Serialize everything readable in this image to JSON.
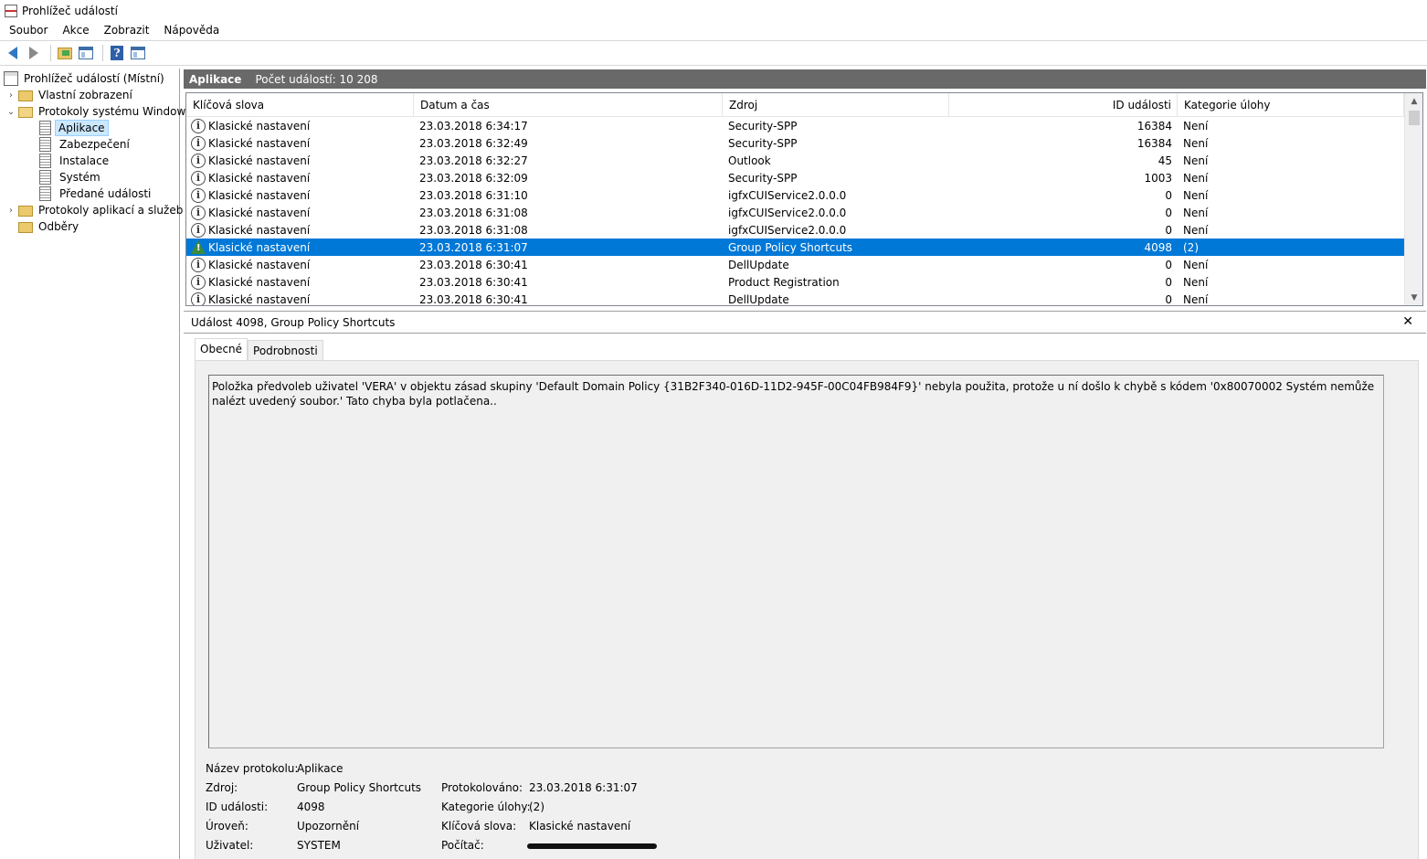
{
  "window": {
    "title": "Prohlížeč událostí"
  },
  "menu": [
    "Soubor",
    "Akce",
    "Zobrazit",
    "Nápověda"
  ],
  "toolbar": {
    "buttons": [
      "back-icon",
      "forward-icon",
      "open-folder-icon",
      "show-hide-tree-icon",
      "help-icon",
      "show-hide-action-pane-icon"
    ]
  },
  "tree": {
    "root": "Prohlížeč událostí (Místní)",
    "custom_views": "Vlastní zobrazení",
    "windows_logs": "Protokoly systému Windows",
    "logs": [
      "Aplikace",
      "Zabezpečení",
      "Instalace",
      "Systém",
      "Předané události"
    ],
    "app_services_logs": "Protokoly aplikací a služeb",
    "subscriptions": "Odběry"
  },
  "log_header": {
    "name": "Aplikace",
    "count_text": "Počet událostí: 10 208"
  },
  "events_table": {
    "columns": [
      "Klíčová slova",
      "Datum a čas",
      "Zdroj",
      "ID události",
      "Kategorie úlohy"
    ],
    "rows": [
      {
        "level": "info",
        "keywords": "Klasické nastavení",
        "datetime": "23.03.2018 6:34:17",
        "source": "Security-SPP",
        "id": "16384",
        "category": "Není"
      },
      {
        "level": "info",
        "keywords": "Klasické nastavení",
        "datetime": "23.03.2018 6:32:49",
        "source": "Security-SPP",
        "id": "16384",
        "category": "Není"
      },
      {
        "level": "info",
        "keywords": "Klasické nastavení",
        "datetime": "23.03.2018 6:32:27",
        "source": "Outlook",
        "id": "45",
        "category": "Není"
      },
      {
        "level": "info",
        "keywords": "Klasické nastavení",
        "datetime": "23.03.2018 6:32:09",
        "source": "Security-SPP",
        "id": "1003",
        "category": "Není"
      },
      {
        "level": "info",
        "keywords": "Klasické nastavení",
        "datetime": "23.03.2018 6:31:10",
        "source": "igfxCUIService2.0.0.0",
        "id": "0",
        "category": "Není"
      },
      {
        "level": "info",
        "keywords": "Klasické nastavení",
        "datetime": "23.03.2018 6:31:08",
        "source": "igfxCUIService2.0.0.0",
        "id": "0",
        "category": "Není"
      },
      {
        "level": "info",
        "keywords": "Klasické nastavení",
        "datetime": "23.03.2018 6:31:08",
        "source": "igfxCUIService2.0.0.0",
        "id": "0",
        "category": "Není"
      },
      {
        "level": "warning",
        "keywords": "Klasické nastavení",
        "datetime": "23.03.2018 6:31:07",
        "source": "Group Policy Shortcuts",
        "id": "4098",
        "category": "(2)"
      },
      {
        "level": "info",
        "keywords": "Klasické nastavení",
        "datetime": "23.03.2018 6:30:41",
        "source": "DellUpdate",
        "id": "0",
        "category": "Není"
      },
      {
        "level": "info",
        "keywords": "Klasické nastavení",
        "datetime": "23.03.2018 6:30:41",
        "source": "Product Registration",
        "id": "0",
        "category": "Není"
      },
      {
        "level": "info",
        "keywords": "Klasické nastavení",
        "datetime": "23.03.2018 6:30:41",
        "source": "DellUpdate",
        "id": "0",
        "category": "Není"
      }
    ],
    "selected_index": 7
  },
  "detail": {
    "title": "Událost 4098, Group Policy Shortcuts",
    "tabs": [
      "Obecné",
      "Podrobnosti"
    ],
    "description": "Položka předvoleb uživatel 'VERA' v objektu zásad skupiny 'Default Domain Policy {31B2F340-016D-11D2-945F-00C04FB984F9}' nebyla použita, protože u ní došlo k chybě s kódem '0x80070002 Systém nemůže nalézt uvedený soubor.' Tato chyba byla potlačena..",
    "props": {
      "log_name_label": "Název protokolu:",
      "log_name": "Aplikace",
      "source_label": "Zdroj:",
      "source": "Group Policy Shortcuts",
      "logged_label": "Protokolováno:",
      "logged": "23.03.2018 6:31:07",
      "event_id_label": "ID události:",
      "event_id": "4098",
      "task_category_label": "Kategorie úlohy:",
      "task_category": "(2)",
      "level_label": "Úroveň:",
      "level": "Upozornění",
      "keywords_label": "Klíčová slova:",
      "keywords": "Klasické nastavení",
      "user_label": "Uživatel:",
      "user": "SYSTEM",
      "computer_label": "Počítač:"
    }
  },
  "colors": {
    "selection": "#0078d7",
    "header_bar": "#696969",
    "tree_selected": "#cce8ff"
  }
}
